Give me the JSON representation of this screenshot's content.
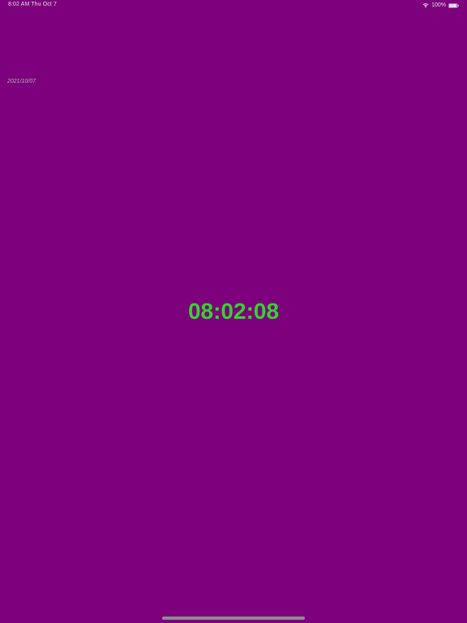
{
  "status_bar": {
    "time_date": "8:02 AM   Thu Oct 7",
    "battery_percent": "100%",
    "wifi_icon": "wifi-icon",
    "battery_icon": "battery-full-icon"
  },
  "date_label": "2021/10/07",
  "clock": {
    "time": "08:02:08",
    "color": "#35d12e"
  },
  "theme": {
    "background": "#7d007d"
  }
}
